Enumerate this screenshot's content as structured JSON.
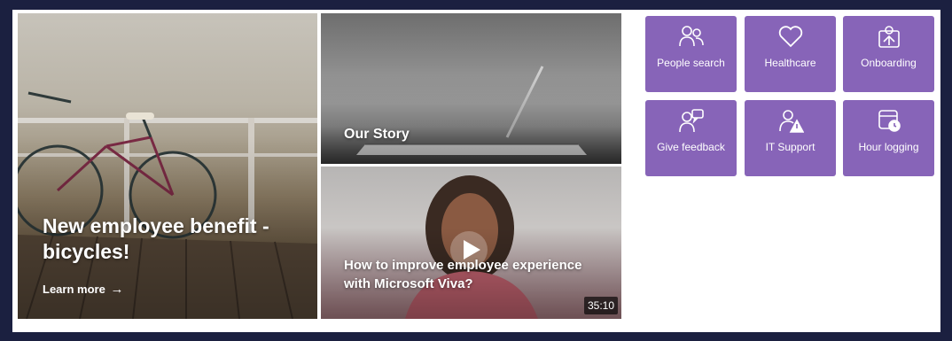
{
  "hero": {
    "main": {
      "title": "New employee benefit - bicycles!",
      "link_label": "Learn more",
      "link_arrow": "→"
    },
    "story": {
      "title": "Our Story"
    },
    "video": {
      "title": "How to improve employee experience with Microsoft Viva?",
      "duration": "35:10"
    }
  },
  "quick_links": [
    {
      "label": "People search",
      "icon": "people-icon"
    },
    {
      "label": "Healthcare",
      "icon": "heart-icon"
    },
    {
      "label": "Onboarding",
      "icon": "onboarding-icon"
    },
    {
      "label": "Give feedback",
      "icon": "feedback-icon"
    },
    {
      "label": "IT Support",
      "icon": "it-support-icon"
    },
    {
      "label": "Hour logging",
      "icon": "hour-logging-icon"
    }
  ],
  "colors": {
    "tile": "#8764b8",
    "background": "#1b2040"
  }
}
